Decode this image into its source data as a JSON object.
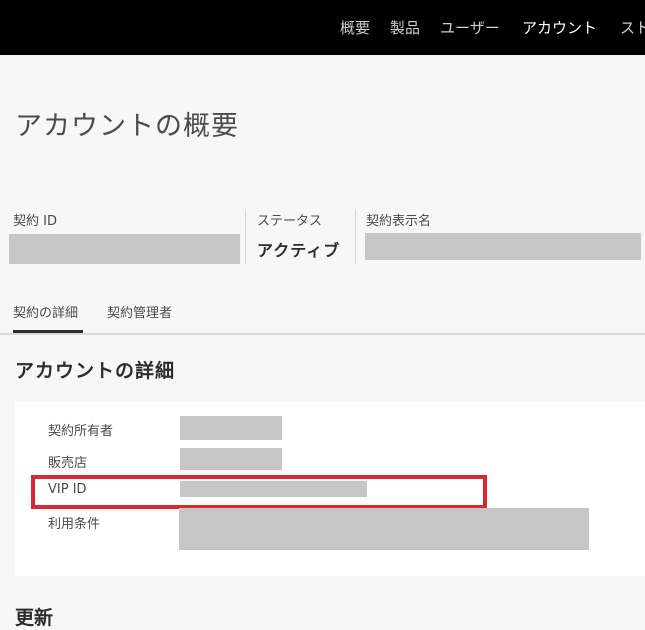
{
  "nav": {
    "items": [
      "概要",
      "製品",
      "ユーザー",
      "アカウント",
      "スト"
    ],
    "active": "アカウント"
  },
  "page": {
    "title": "アカウントの概要"
  },
  "summary": {
    "contract_id_label": "契約 ID",
    "status_label": "ステータス",
    "status_value": "アクティブ",
    "display_name_label": "契約表示名"
  },
  "tabs": {
    "items": [
      "契約の詳細",
      "契約管理者"
    ],
    "active": "契約の詳細"
  },
  "details": {
    "heading": "アカウントの詳細",
    "owner_label": "契約所有者",
    "reseller_label": "販売店",
    "vip_id_label": "VIP ID",
    "terms_label": "利用条件"
  },
  "next_section": {
    "heading": "更新"
  },
  "colors": {
    "nav_background": "#000000",
    "highlight": "#d92630",
    "redaction": "#c6c6c6"
  }
}
